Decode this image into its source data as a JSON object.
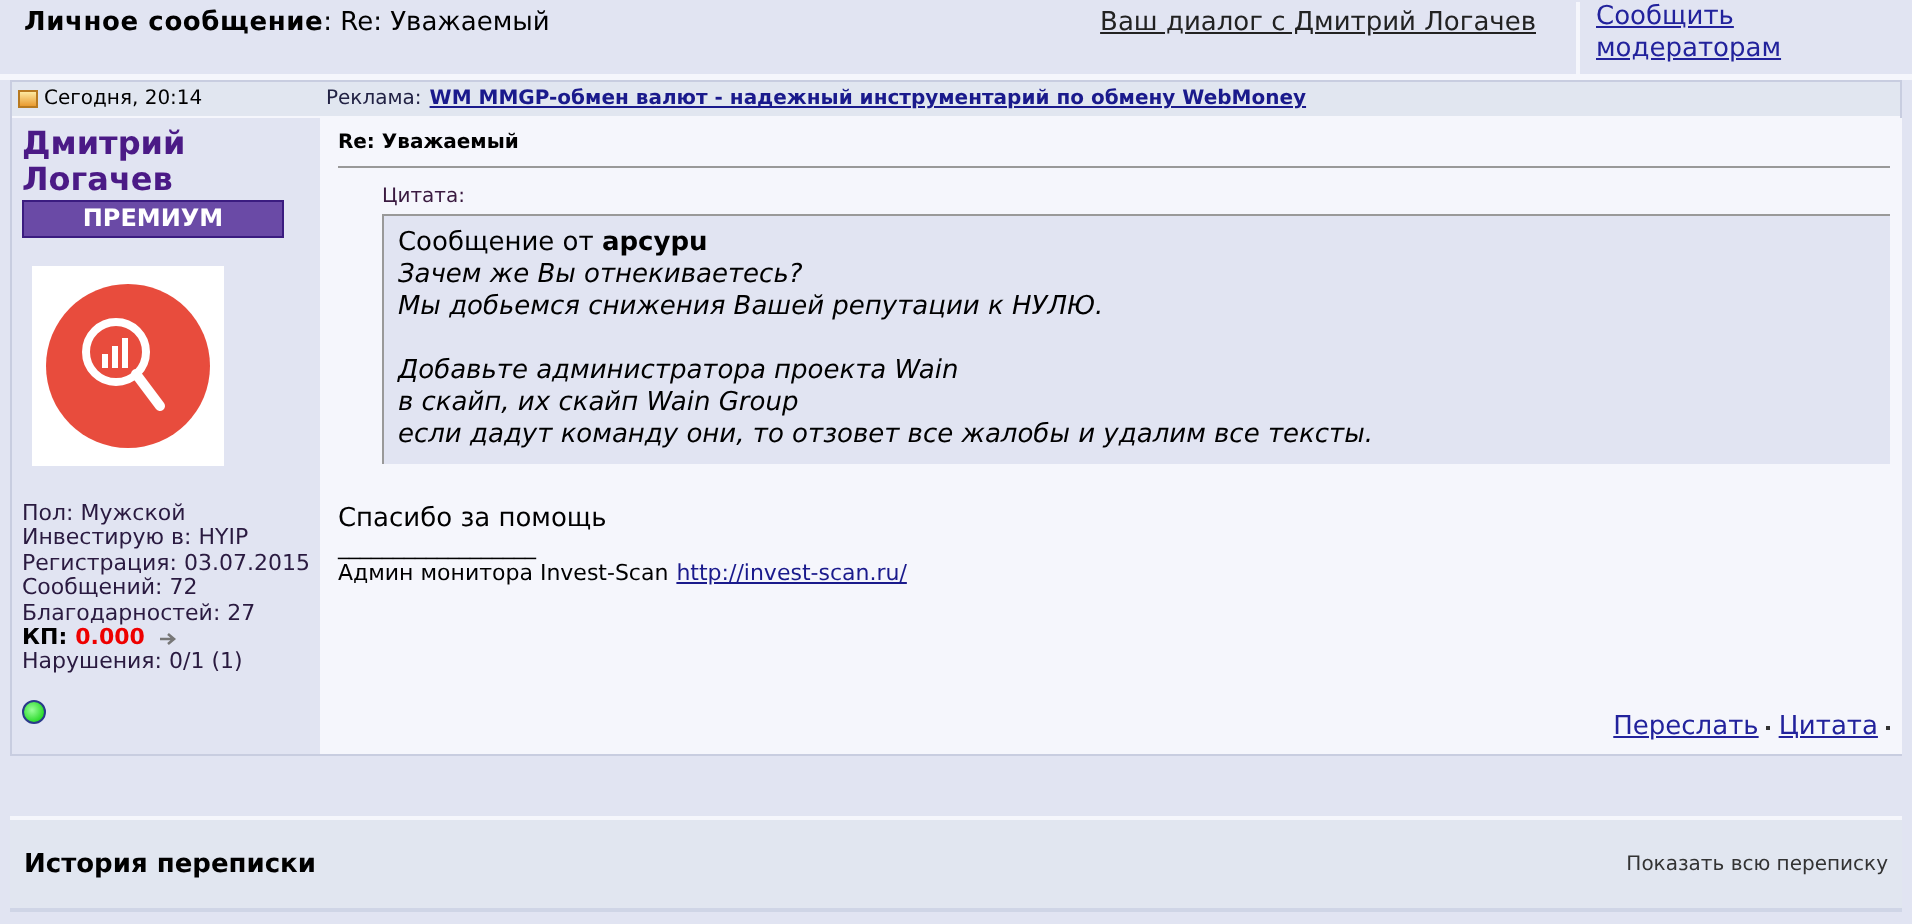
{
  "header": {
    "title_label": "Личное сообщение",
    "title_separator": ":",
    "title_value": "Re: Уважаемый",
    "dialog_link": "Ваш диалог с Дмитрий Логачев",
    "report_link": "Сообщить модераторам"
  },
  "post": {
    "date": "Сегодня, 20:14",
    "ad_label": "Реклама:",
    "ad_link": "WM MMGP-обмен валют - надежный инструментарий по обмену WebMoney",
    "author": {
      "name": "Дмитрий Логачев",
      "badge": "ПРЕМИУМ",
      "online": true,
      "stats": [
        {
          "kind": "plain",
          "text": "Пол: Мужской"
        },
        {
          "kind": "plain",
          "text": "Инвестирую в: HYIP"
        },
        {
          "kind": "plain",
          "text": "Регистрация: 03.07.2015"
        },
        {
          "kind": "plain",
          "text": "Сообщений: 72"
        },
        {
          "kind": "plain",
          "text": "Благодарностей: 27"
        },
        {
          "kind": "rating",
          "label": "КП:",
          "value": "0.000"
        },
        {
          "kind": "plain",
          "text": "Нарушения: 0/1 (1)"
        }
      ]
    },
    "subject": "Re: Уважаемый",
    "quote": {
      "label": "Цитата:",
      "from": "Сообщение от **apcypu**",
      "paragraphs": [
        [
          "Зачем же Вы отнекиваетесь?",
          "Мы добьемся снижения Вашей репутации к НУЛЮ."
        ],
        [
          "Добавьте администратора проекта Wain",
          "в скайп, их скайп Wain Group",
          "если дадут команду они, то отзовет все жалобы и удалим все тексты."
        ]
      ]
    },
    "body": "Спасибо за помощь",
    "signature_rule": "__________________",
    "signature_text": "Админ монитора Invest-Scan",
    "signature_link": "http://invest-scan.ru/",
    "actions": [
      {
        "label": "Переслать"
      },
      {
        "label": "Цитата"
      }
    ]
  },
  "history": {
    "title": "История переписки",
    "show_all": "Показать всю переписку"
  }
}
